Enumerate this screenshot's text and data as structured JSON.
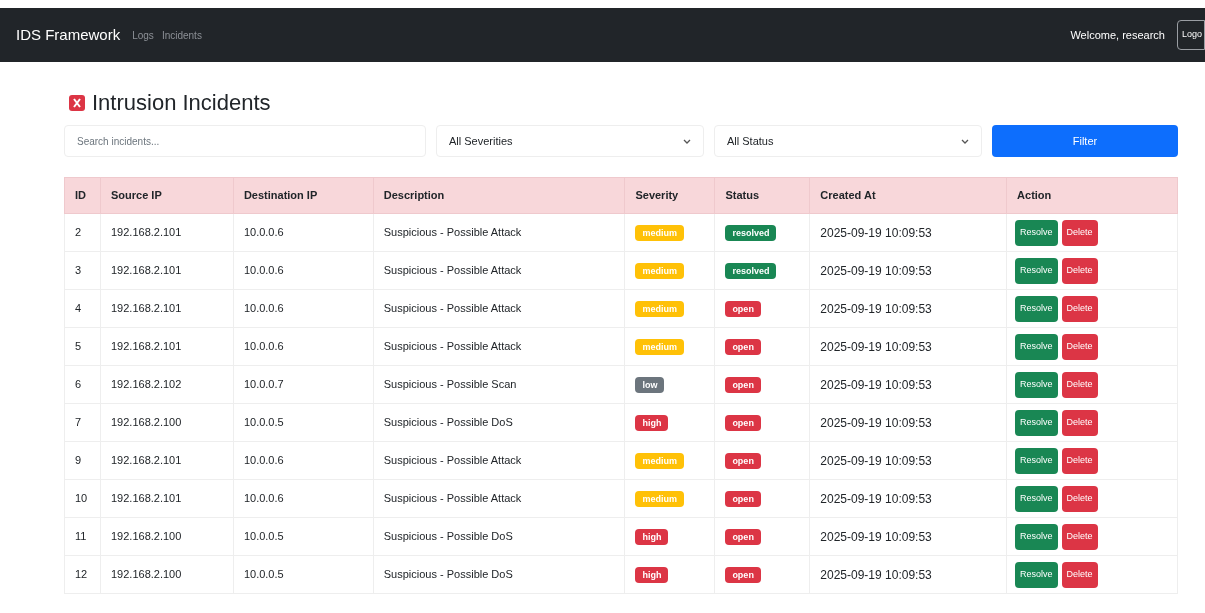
{
  "navbar": {
    "brand": "IDS Framework",
    "links": [
      "Logs",
      "Incidents"
    ],
    "welcome": "Welcome, research",
    "logout": "Logo"
  },
  "page": {
    "title": "Intrusion Incidents"
  },
  "filters": {
    "search": {
      "placeholder": "Search incidents..."
    },
    "severity": {
      "value": "All Severities"
    },
    "status": {
      "value": "All Status"
    },
    "button": "Filter"
  },
  "table": {
    "columns": [
      "ID",
      "Source IP",
      "Destination IP",
      "Description",
      "Severity",
      "Status",
      "Created At",
      "Action"
    ],
    "rows": [
      {
        "id": "2",
        "source_ip": "192.168.2.101",
        "destination_ip": "10.0.0.6",
        "description": "Suspicious - Possible Attack",
        "severity": {
          "label": "medium",
          "kind": "medium"
        },
        "status": {
          "label": "resolved",
          "kind": "resolved"
        },
        "created_at": "2025-09-19 10:09:53",
        "actions": [
          "Resolve",
          "Delete"
        ]
      },
      {
        "id": "3",
        "source_ip": "192.168.2.101",
        "destination_ip": "10.0.0.6",
        "description": "Suspicious - Possible Attack",
        "severity": {
          "label": "medium",
          "kind": "medium"
        },
        "status": {
          "label": "resolved",
          "kind": "resolved"
        },
        "created_at": "2025-09-19 10:09:53",
        "actions": [
          "Resolve",
          "Delete"
        ]
      },
      {
        "id": "4",
        "source_ip": "192.168.2.101",
        "destination_ip": "10.0.0.6",
        "description": "Suspicious - Possible Attack",
        "severity": {
          "label": "medium",
          "kind": "medium"
        },
        "status": {
          "label": "open",
          "kind": "open"
        },
        "created_at": "2025-09-19 10:09:53",
        "actions": [
          "Resolve",
          "Delete"
        ]
      },
      {
        "id": "5",
        "source_ip": "192.168.2.101",
        "destination_ip": "10.0.0.6",
        "description": "Suspicious - Possible Attack",
        "severity": {
          "label": "medium",
          "kind": "medium"
        },
        "status": {
          "label": "open",
          "kind": "open"
        },
        "created_at": "2025-09-19 10:09:53",
        "actions": [
          "Resolve",
          "Delete"
        ]
      },
      {
        "id": "6",
        "source_ip": "192.168.2.102",
        "destination_ip": "10.0.0.7",
        "description": "Suspicious - Possible Scan",
        "severity": {
          "label": "low",
          "kind": "low"
        },
        "status": {
          "label": "open",
          "kind": "open"
        },
        "created_at": "2025-09-19 10:09:53",
        "actions": [
          "Resolve",
          "Delete"
        ]
      },
      {
        "id": "7",
        "source_ip": "192.168.2.100",
        "destination_ip": "10.0.0.5",
        "description": "Suspicious - Possible DoS",
        "severity": {
          "label": "high",
          "kind": "high"
        },
        "status": {
          "label": "open",
          "kind": "open"
        },
        "created_at": "2025-09-19 10:09:53",
        "actions": [
          "Resolve",
          "Delete"
        ]
      },
      {
        "id": "9",
        "source_ip": "192.168.2.101",
        "destination_ip": "10.0.0.6",
        "description": "Suspicious - Possible Attack",
        "severity": {
          "label": "medium",
          "kind": "medium"
        },
        "status": {
          "label": "open",
          "kind": "open"
        },
        "created_at": "2025-09-19 10:09:53",
        "actions": [
          "Resolve",
          "Delete"
        ]
      },
      {
        "id": "10",
        "source_ip": "192.168.2.101",
        "destination_ip": "10.0.0.6",
        "description": "Suspicious - Possible Attack",
        "severity": {
          "label": "medium",
          "kind": "medium"
        },
        "status": {
          "label": "open",
          "kind": "open"
        },
        "created_at": "2025-09-19 10:09:53",
        "actions": [
          "Resolve",
          "Delete"
        ]
      },
      {
        "id": "11",
        "source_ip": "192.168.2.100",
        "destination_ip": "10.0.0.5",
        "description": "Suspicious - Possible DoS",
        "severity": {
          "label": "high",
          "kind": "high"
        },
        "status": {
          "label": "open",
          "kind": "open"
        },
        "created_at": "2025-09-19 10:09:53",
        "actions": [
          "Resolve",
          "Delete"
        ]
      },
      {
        "id": "12",
        "source_ip": "192.168.2.100",
        "destination_ip": "10.0.0.5",
        "description": "Suspicious - Possible DoS",
        "severity": {
          "label": "high",
          "kind": "high"
        },
        "status": {
          "label": "open",
          "kind": "open"
        },
        "created_at": "2025-09-19 10:09:53",
        "actions": [
          "Resolve",
          "Delete"
        ]
      }
    ]
  }
}
